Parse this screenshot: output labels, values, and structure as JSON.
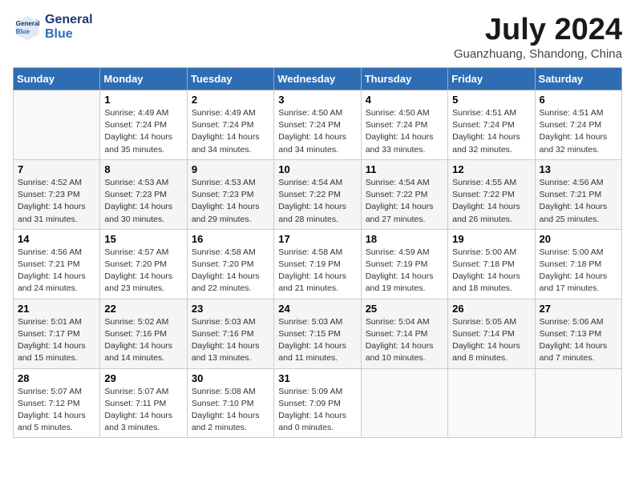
{
  "header": {
    "logo_line1": "General",
    "logo_line2": "Blue",
    "month_title": "July 2024",
    "subtitle": "Guanzhuang, Shandong, China"
  },
  "days_of_week": [
    "Sunday",
    "Monday",
    "Tuesday",
    "Wednesday",
    "Thursday",
    "Friday",
    "Saturday"
  ],
  "weeks": [
    [
      {
        "day": "",
        "info": ""
      },
      {
        "day": "1",
        "info": "Sunrise: 4:49 AM\nSunset: 7:24 PM\nDaylight: 14 hours\nand 35 minutes."
      },
      {
        "day": "2",
        "info": "Sunrise: 4:49 AM\nSunset: 7:24 PM\nDaylight: 14 hours\nand 34 minutes."
      },
      {
        "day": "3",
        "info": "Sunrise: 4:50 AM\nSunset: 7:24 PM\nDaylight: 14 hours\nand 34 minutes."
      },
      {
        "day": "4",
        "info": "Sunrise: 4:50 AM\nSunset: 7:24 PM\nDaylight: 14 hours\nand 33 minutes."
      },
      {
        "day": "5",
        "info": "Sunrise: 4:51 AM\nSunset: 7:24 PM\nDaylight: 14 hours\nand 32 minutes."
      },
      {
        "day": "6",
        "info": "Sunrise: 4:51 AM\nSunset: 7:24 PM\nDaylight: 14 hours\nand 32 minutes."
      }
    ],
    [
      {
        "day": "7",
        "info": "Sunrise: 4:52 AM\nSunset: 7:23 PM\nDaylight: 14 hours\nand 31 minutes."
      },
      {
        "day": "8",
        "info": "Sunrise: 4:53 AM\nSunset: 7:23 PM\nDaylight: 14 hours\nand 30 minutes."
      },
      {
        "day": "9",
        "info": "Sunrise: 4:53 AM\nSunset: 7:23 PM\nDaylight: 14 hours\nand 29 minutes."
      },
      {
        "day": "10",
        "info": "Sunrise: 4:54 AM\nSunset: 7:22 PM\nDaylight: 14 hours\nand 28 minutes."
      },
      {
        "day": "11",
        "info": "Sunrise: 4:54 AM\nSunset: 7:22 PM\nDaylight: 14 hours\nand 27 minutes."
      },
      {
        "day": "12",
        "info": "Sunrise: 4:55 AM\nSunset: 7:22 PM\nDaylight: 14 hours\nand 26 minutes."
      },
      {
        "day": "13",
        "info": "Sunrise: 4:56 AM\nSunset: 7:21 PM\nDaylight: 14 hours\nand 25 minutes."
      }
    ],
    [
      {
        "day": "14",
        "info": "Sunrise: 4:56 AM\nSunset: 7:21 PM\nDaylight: 14 hours\nand 24 minutes."
      },
      {
        "day": "15",
        "info": "Sunrise: 4:57 AM\nSunset: 7:20 PM\nDaylight: 14 hours\nand 23 minutes."
      },
      {
        "day": "16",
        "info": "Sunrise: 4:58 AM\nSunset: 7:20 PM\nDaylight: 14 hours\nand 22 minutes."
      },
      {
        "day": "17",
        "info": "Sunrise: 4:58 AM\nSunset: 7:19 PM\nDaylight: 14 hours\nand 21 minutes."
      },
      {
        "day": "18",
        "info": "Sunrise: 4:59 AM\nSunset: 7:19 PM\nDaylight: 14 hours\nand 19 minutes."
      },
      {
        "day": "19",
        "info": "Sunrise: 5:00 AM\nSunset: 7:18 PM\nDaylight: 14 hours\nand 18 minutes."
      },
      {
        "day": "20",
        "info": "Sunrise: 5:00 AM\nSunset: 7:18 PM\nDaylight: 14 hours\nand 17 minutes."
      }
    ],
    [
      {
        "day": "21",
        "info": "Sunrise: 5:01 AM\nSunset: 7:17 PM\nDaylight: 14 hours\nand 15 minutes."
      },
      {
        "day": "22",
        "info": "Sunrise: 5:02 AM\nSunset: 7:16 PM\nDaylight: 14 hours\nand 14 minutes."
      },
      {
        "day": "23",
        "info": "Sunrise: 5:03 AM\nSunset: 7:16 PM\nDaylight: 14 hours\nand 13 minutes."
      },
      {
        "day": "24",
        "info": "Sunrise: 5:03 AM\nSunset: 7:15 PM\nDaylight: 14 hours\nand 11 minutes."
      },
      {
        "day": "25",
        "info": "Sunrise: 5:04 AM\nSunset: 7:14 PM\nDaylight: 14 hours\nand 10 minutes."
      },
      {
        "day": "26",
        "info": "Sunrise: 5:05 AM\nSunset: 7:14 PM\nDaylight: 14 hours\nand 8 minutes."
      },
      {
        "day": "27",
        "info": "Sunrise: 5:06 AM\nSunset: 7:13 PM\nDaylight: 14 hours\nand 7 minutes."
      }
    ],
    [
      {
        "day": "28",
        "info": "Sunrise: 5:07 AM\nSunset: 7:12 PM\nDaylight: 14 hours\nand 5 minutes."
      },
      {
        "day": "29",
        "info": "Sunrise: 5:07 AM\nSunset: 7:11 PM\nDaylight: 14 hours\nand 3 minutes."
      },
      {
        "day": "30",
        "info": "Sunrise: 5:08 AM\nSunset: 7:10 PM\nDaylight: 14 hours\nand 2 minutes."
      },
      {
        "day": "31",
        "info": "Sunrise: 5:09 AM\nSunset: 7:09 PM\nDaylight: 14 hours\nand 0 minutes."
      },
      {
        "day": "",
        "info": ""
      },
      {
        "day": "",
        "info": ""
      },
      {
        "day": "",
        "info": ""
      }
    ]
  ]
}
